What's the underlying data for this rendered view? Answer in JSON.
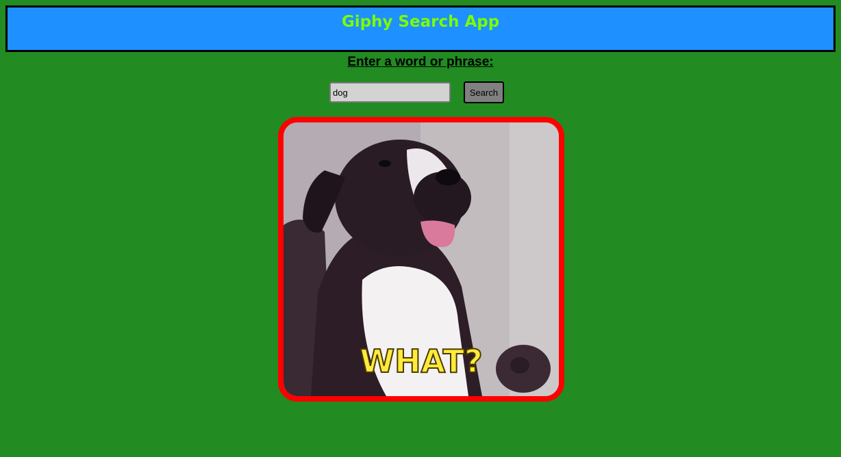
{
  "header": {
    "title": "Giphy Search App"
  },
  "search": {
    "prompt": "Enter a word or phrase:",
    "value": "dog",
    "button_label": "Search"
  },
  "result": {
    "caption": "WHAT?",
    "subject": "dog-gif"
  },
  "colors": {
    "page_background": "#228b22",
    "header_background": "#1e90ff",
    "title_color": "#7cfc00",
    "frame_border": "#ff0000",
    "button_background": "#808080",
    "input_background": "#d3d3d3"
  }
}
